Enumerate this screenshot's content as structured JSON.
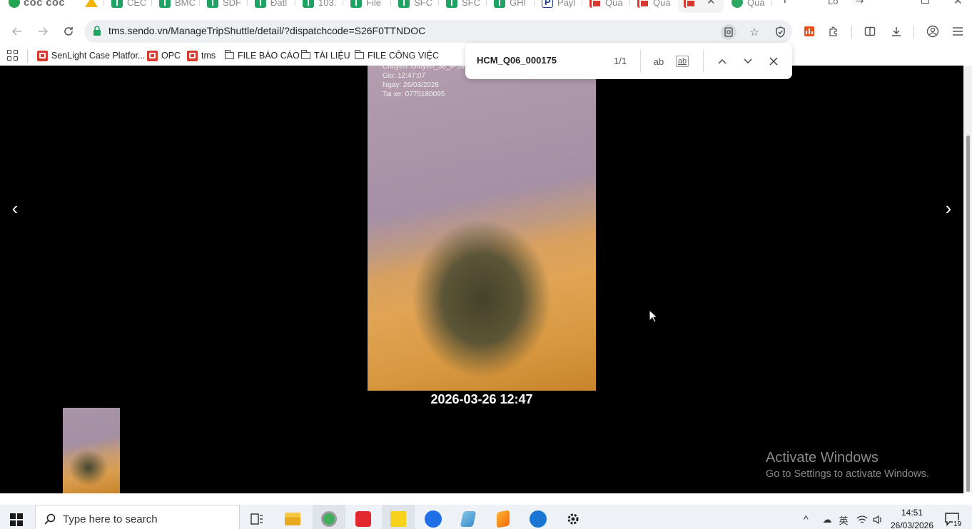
{
  "browser": {
    "brand": "cốc cốc",
    "tabs": [
      {
        "label": "CEC",
        "icon": "sheet"
      },
      {
        "label": "BMC",
        "icon": "sheet"
      },
      {
        "label": "SDF",
        "icon": "sheet"
      },
      {
        "label": "Đatl",
        "icon": "sheet"
      },
      {
        "label": "103.",
        "icon": "sheet"
      },
      {
        "label": "File",
        "icon": "sheet"
      },
      {
        "label": "SFC",
        "icon": "sheet"
      },
      {
        "label": "SFC",
        "icon": "sheet"
      },
      {
        "label": "GHI",
        "icon": "sheet"
      },
      {
        "label": "Payl",
        "icon": "paypal"
      },
      {
        "label": "Quả",
        "icon": "red"
      },
      {
        "label": "Quả",
        "icon": "red"
      },
      {
        "label": "",
        "icon": "red"
      },
      {
        "label": "Quả",
        "icon": "green-round"
      }
    ],
    "tab_close_glyph": "✕",
    "new_tab_glyph": "+",
    "tab_search_label": "Lo",
    "address": {
      "url": "tms.sendo.vn/ManageTripShuttle/detail/?dispatchcode=S26F0TTNDOC"
    },
    "bookmarks": [
      {
        "label": "SenLight Case Platfor...",
        "icon": "sendo"
      },
      {
        "label": "OPC",
        "icon": "sendo"
      },
      {
        "label": "tms",
        "icon": "sendo"
      },
      {
        "label": "FILE BÁO CÁO",
        "icon": "folder"
      },
      {
        "label": "TÀI LIỆU",
        "icon": "folder"
      },
      {
        "label": "FILE CÔNG VIỆC",
        "icon": "folder"
      }
    ]
  },
  "find_bar": {
    "query": "HCM_Q06_000175",
    "count": "1/1",
    "match_case_label": "ab",
    "whole_word_label": "ab"
  },
  "viewer": {
    "photo_overlay": {
      "line1": "Chuyen: chuyen_38_IP59",
      "line2": "Gio: 12:47:07",
      "line3": "Ngay: 26/03/2026",
      "line4": "Tai xe: 0775180095"
    },
    "timestamp": "2026-03-26 12:47",
    "prev_glyph": "‹",
    "next_glyph": "›"
  },
  "watermark": {
    "title": "Activate Windows",
    "subtitle": "Go to Settings to activate Windows."
  },
  "taskbar": {
    "search_placeholder": "Type here to search",
    "clock_time": "14:51",
    "clock_date": "26/03/2026",
    "notification_count": "19",
    "tray_lang": "英"
  }
}
